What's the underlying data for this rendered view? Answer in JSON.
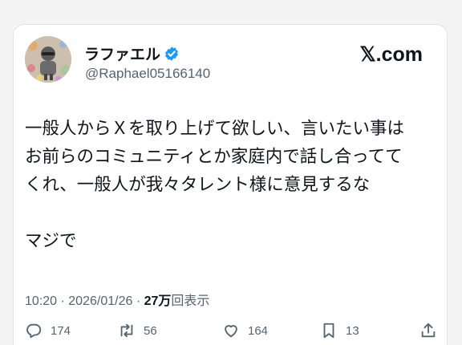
{
  "header_fragment": "",
  "tweet": {
    "display_name": "ラファエル",
    "handle": "@Raphael05166140",
    "brand": "𝕏.com",
    "body_lines": [
      "一般人からＸを取り上げて欲しい、言いたい事は",
      "お前らのコミュニティとか家庭内で話し合ってて",
      "くれ、一般人が我々タレント様に意見するな"
    ],
    "body_last": "マジで",
    "time": "10:20",
    "date": "2026/01/26",
    "views_count": "27万",
    "views_label": "回表示",
    "separator": "·"
  },
  "actions": {
    "reply_count": "174",
    "retweet_count": "56",
    "like_count": "164",
    "bookmark_count": "13"
  },
  "colors": {
    "verified": "#1d9bf0",
    "text": "#0f1419",
    "muted": "#536471"
  }
}
